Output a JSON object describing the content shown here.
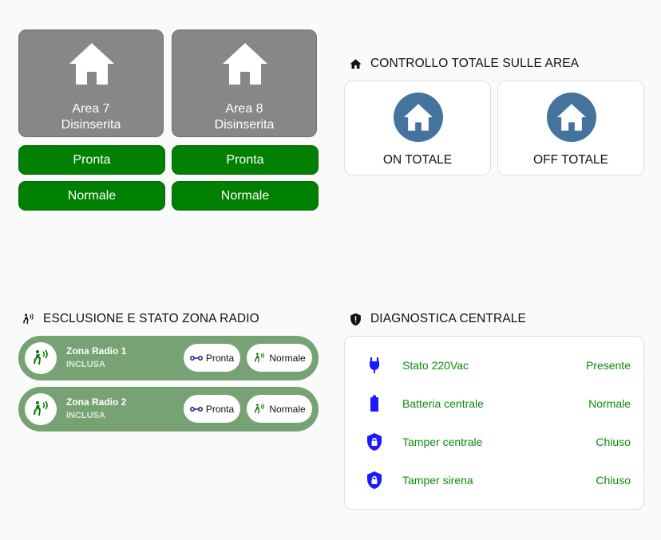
{
  "areas": [
    {
      "name": "Area 7",
      "state": "Disinserita",
      "ready": "Pronta",
      "status": "Normale"
    },
    {
      "name": "Area 8",
      "state": "Disinserita",
      "ready": "Pronta",
      "status": "Normale"
    }
  ],
  "totale": {
    "title": "CONTROLLO TOTALE SULLE AREA",
    "on_label": "ON TOTALE",
    "off_label": "OFF TOTALE"
  },
  "zone_section": {
    "title": "ESCLUSIONE E STATO ZONA RADIO",
    "zones": [
      {
        "name": "Zona Radio 1",
        "state": "INCLUSA",
        "ready": "Pronta",
        "status": "Normale"
      },
      {
        "name": "Zona Radio 2",
        "state": "INCLUSA",
        "ready": "Pronta",
        "status": "Normale"
      }
    ]
  },
  "diagnostica": {
    "title": "DIAGNOSTICA CENTRALE",
    "rows": [
      {
        "icon": "power-plug-icon",
        "label": "Stato 220Vac",
        "value": "Presente"
      },
      {
        "icon": "battery-icon",
        "label": "Batteria centrale",
        "value": "Normale"
      },
      {
        "icon": "shield-lock-icon",
        "label": "Tamper centrale",
        "value": "Chiuso"
      },
      {
        "icon": "shield-lock-icon",
        "label": "Tamper sirena",
        "value": "Chiuso"
      }
    ]
  },
  "colors": {
    "area_tile": "#878787",
    "ok_green": "#008000",
    "totale_circle": "#44739e",
    "zone_pill": "#77a274",
    "diag_text": "#0f8a0f",
    "diag_icon": "#1a1aff"
  }
}
